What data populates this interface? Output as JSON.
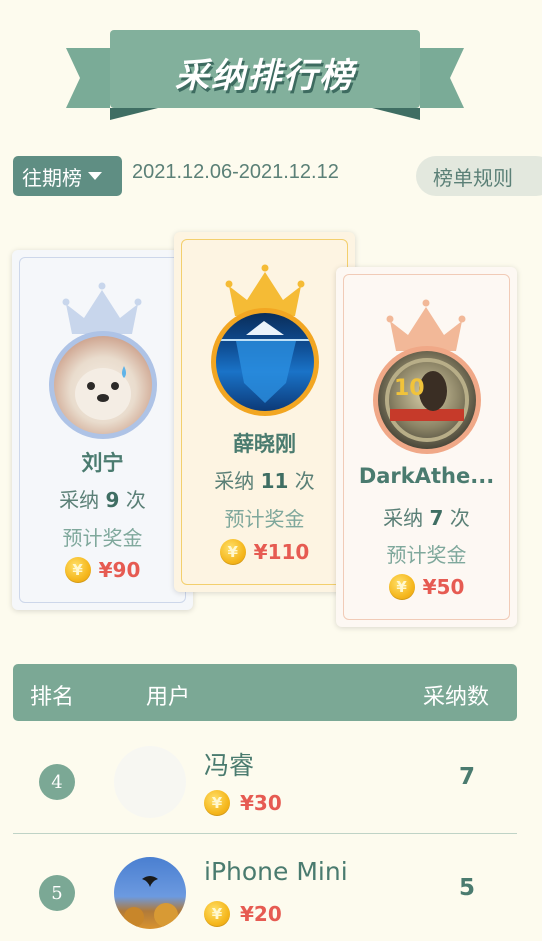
{
  "banner": {
    "title": "采纳排行榜"
  },
  "toolbar": {
    "period_label": "往期榜",
    "date_range": "2021.12.06-2021.12.12",
    "rules_label": "榜单规则"
  },
  "podium": {
    "count_prefix": "采纳",
    "count_suffix": "次",
    "prize_label": "预计奖金",
    "currency": "¥",
    "coin_symbol": "¥",
    "second": {
      "name": "刘宁",
      "count": "9",
      "prize": "¥90"
    },
    "first": {
      "name": "薛晓刚",
      "count": "11",
      "prize": "¥110"
    },
    "third": {
      "name": "DarkAthe...",
      "count": "7",
      "prize": "¥50"
    }
  },
  "table": {
    "headers": {
      "rank": "排名",
      "user": "用户",
      "count": "采纳数"
    },
    "rows": [
      {
        "rank": "4",
        "name": "冯睿",
        "prize": "¥30",
        "count": "7"
      },
      {
        "rank": "5",
        "name": "iPhone Mini",
        "prize": "¥20",
        "count": "5"
      }
    ]
  },
  "colors": {
    "background": "#fdfbee",
    "accent": "#7ba895",
    "prize_red": "#e65b52",
    "gold": "#f5b71d"
  }
}
